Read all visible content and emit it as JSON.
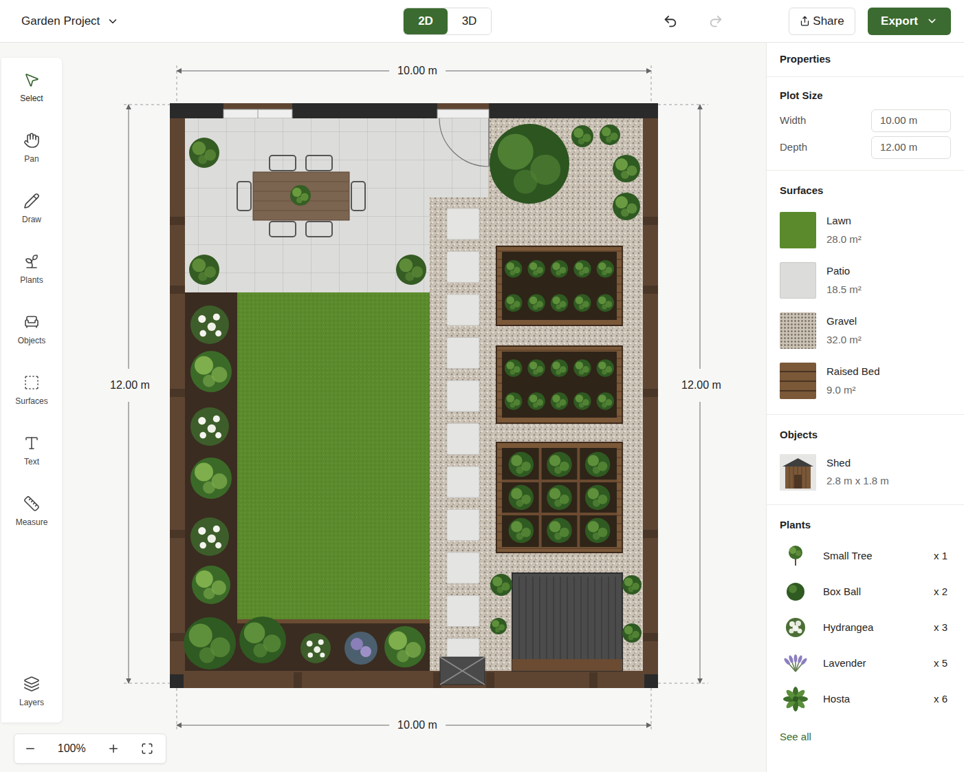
{
  "project": {
    "title": "Garden Project"
  },
  "view_modes": [
    {
      "label": "2D",
      "selected": true
    },
    {
      "label": "3D",
      "selected": false
    }
  ],
  "header_buttons": {
    "share": "Share",
    "export": "Export"
  },
  "tools": [
    {
      "label": "Select",
      "selected": true
    },
    {
      "label": "Pan",
      "selected": false
    },
    {
      "label": "Draw",
      "selected": false
    },
    {
      "label": "Plants",
      "selected": false
    },
    {
      "label": "Objects",
      "selected": false
    },
    {
      "label": "Surfaces",
      "selected": false
    },
    {
      "label": "Text",
      "selected": false
    },
    {
      "label": "Measure",
      "selected": false
    }
  ],
  "layers": {
    "label": "Layers"
  },
  "zoom": {
    "value": "100%"
  },
  "canvas": {
    "dimensions": {
      "top": "10.00 m",
      "bottom": "10.00 m",
      "left": "12.00 m",
      "right": "12.00 m"
    }
  },
  "properties": {
    "title": "Properties",
    "plot_size": {
      "title": "Plot Size",
      "fields": [
        {
          "label": "Width",
          "value": "10.00 m"
        },
        {
          "label": "Depth",
          "value": "12.00 m"
        }
      ]
    },
    "surfaces": {
      "title": "Surfaces",
      "items": [
        {
          "name": "Lawn",
          "area": "28.0 m²",
          "color": "#5a8a2c"
        },
        {
          "name": "Patio",
          "area": "18.5 m²",
          "color": "#dcdcda"
        },
        {
          "name": "Gravel",
          "area": "32.0 m²",
          "color": "#cbc2b6"
        },
        {
          "name": "Raised Bed",
          "area": "9.0 m²",
          "color": "#7a5838"
        }
      ]
    },
    "objects": {
      "title": "Objects",
      "items": [
        {
          "name": "Shed",
          "size": "2.8 m x 1.8 m"
        }
      ]
    },
    "plants": {
      "title": "Plants",
      "items": [
        {
          "name": "Small Tree",
          "count": "x 1"
        },
        {
          "name": "Box Ball",
          "count": "x 2"
        },
        {
          "name": "Hydrangea",
          "count": "x 3"
        },
        {
          "name": "Lavender",
          "count": "x 5"
        },
        {
          "name": "Hosta",
          "count": "x 6"
        }
      ],
      "see_all": "See all"
    }
  }
}
